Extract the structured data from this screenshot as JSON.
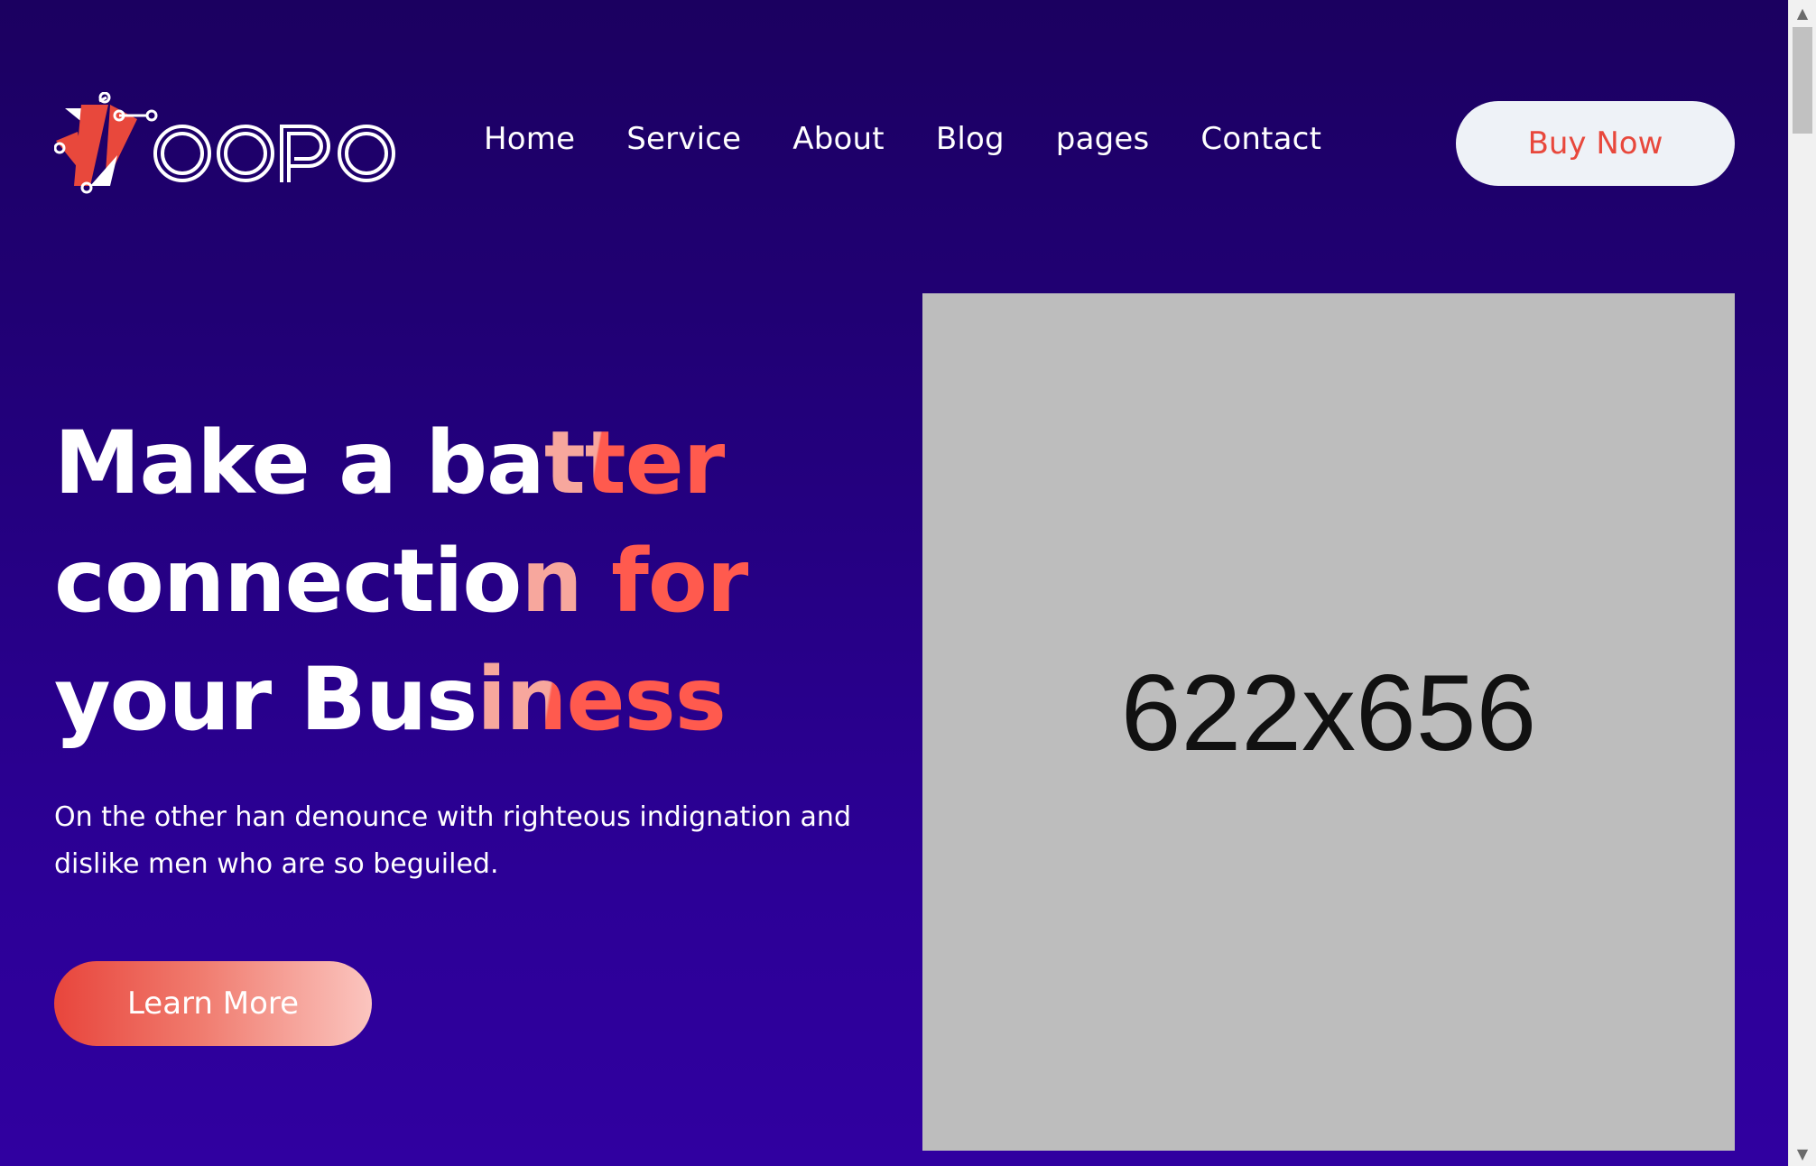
{
  "header": {
    "logo_alt": "Voopo",
    "nav": [
      "Home",
      "Service",
      "About",
      "Blog",
      "pages",
      "Contact"
    ],
    "cta_label": "Buy Now"
  },
  "hero": {
    "title_lines": [
      {
        "white": "Make a ba",
        "accent": "tter"
      },
      {
        "white": "connectio",
        "accent": "n for"
      },
      {
        "white": "your Bus",
        "accent": "iness"
      }
    ],
    "description": "On the other han denounce with righteous indignation and dislike men who are so beguiled.",
    "button_label": "Learn More",
    "image_placeholder": "622x656"
  },
  "colors": {
    "background_top": "#1b0060",
    "background_bottom": "#3000a0",
    "accent": "#ff5a4e",
    "accent_light": "#f7a79d",
    "cta_bg": "#eef2f7",
    "cta_text": "#e8483c",
    "placeholder_bg": "#bdbdbd"
  },
  "icons": {
    "logo": "voopo-logo",
    "scroll_up": "scroll-up-arrow-icon",
    "scroll_down": "scroll-down-arrow-icon"
  }
}
